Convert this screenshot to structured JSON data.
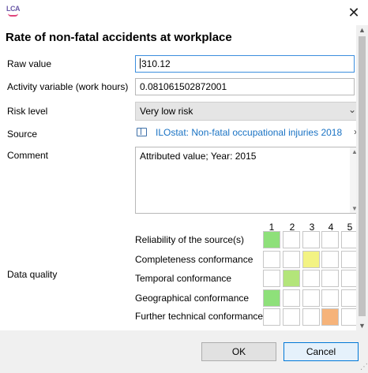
{
  "window": {
    "logo_text": "LCA",
    "close_label": "✕"
  },
  "dialog": {
    "title": "Rate of non-fatal accidents at workplace",
    "raw_value": {
      "label": "Raw value",
      "value": "310.12"
    },
    "activity": {
      "label": "Activity variable (work hours)",
      "value": "0.081061502872001"
    },
    "risk": {
      "label": "Risk level",
      "value": "Very low risk"
    },
    "source": {
      "label": "Source",
      "value": "ILOstat: Non-fatal occupational injuries 2018"
    },
    "comment": {
      "label": "Comment",
      "value": "Attributed value; Year: 2015"
    },
    "data_quality": {
      "label": "Data quality",
      "columns": [
        "1",
        "2",
        "3",
        "4",
        "5"
      ],
      "rows": [
        {
          "label": "Reliability of the source(s)",
          "selected": 1,
          "color": "#8ee07a"
        },
        {
          "label": "Completeness conformance",
          "selected": 3,
          "color": "#f3f383"
        },
        {
          "label": "Temporal conformance",
          "selected": 2,
          "color": "#b3e57a"
        },
        {
          "label": "Geographical  conformance",
          "selected": 1,
          "color": "#8ee07a"
        },
        {
          "label": "Further technical conformance",
          "selected": 4,
          "color": "#f6b37a"
        }
      ]
    }
  },
  "buttons": {
    "ok": "OK",
    "cancel": "Cancel"
  },
  "colors": {
    "link": "#1a73c4",
    "focus": "#3b8ede",
    "primary_border": "#0078d7"
  }
}
